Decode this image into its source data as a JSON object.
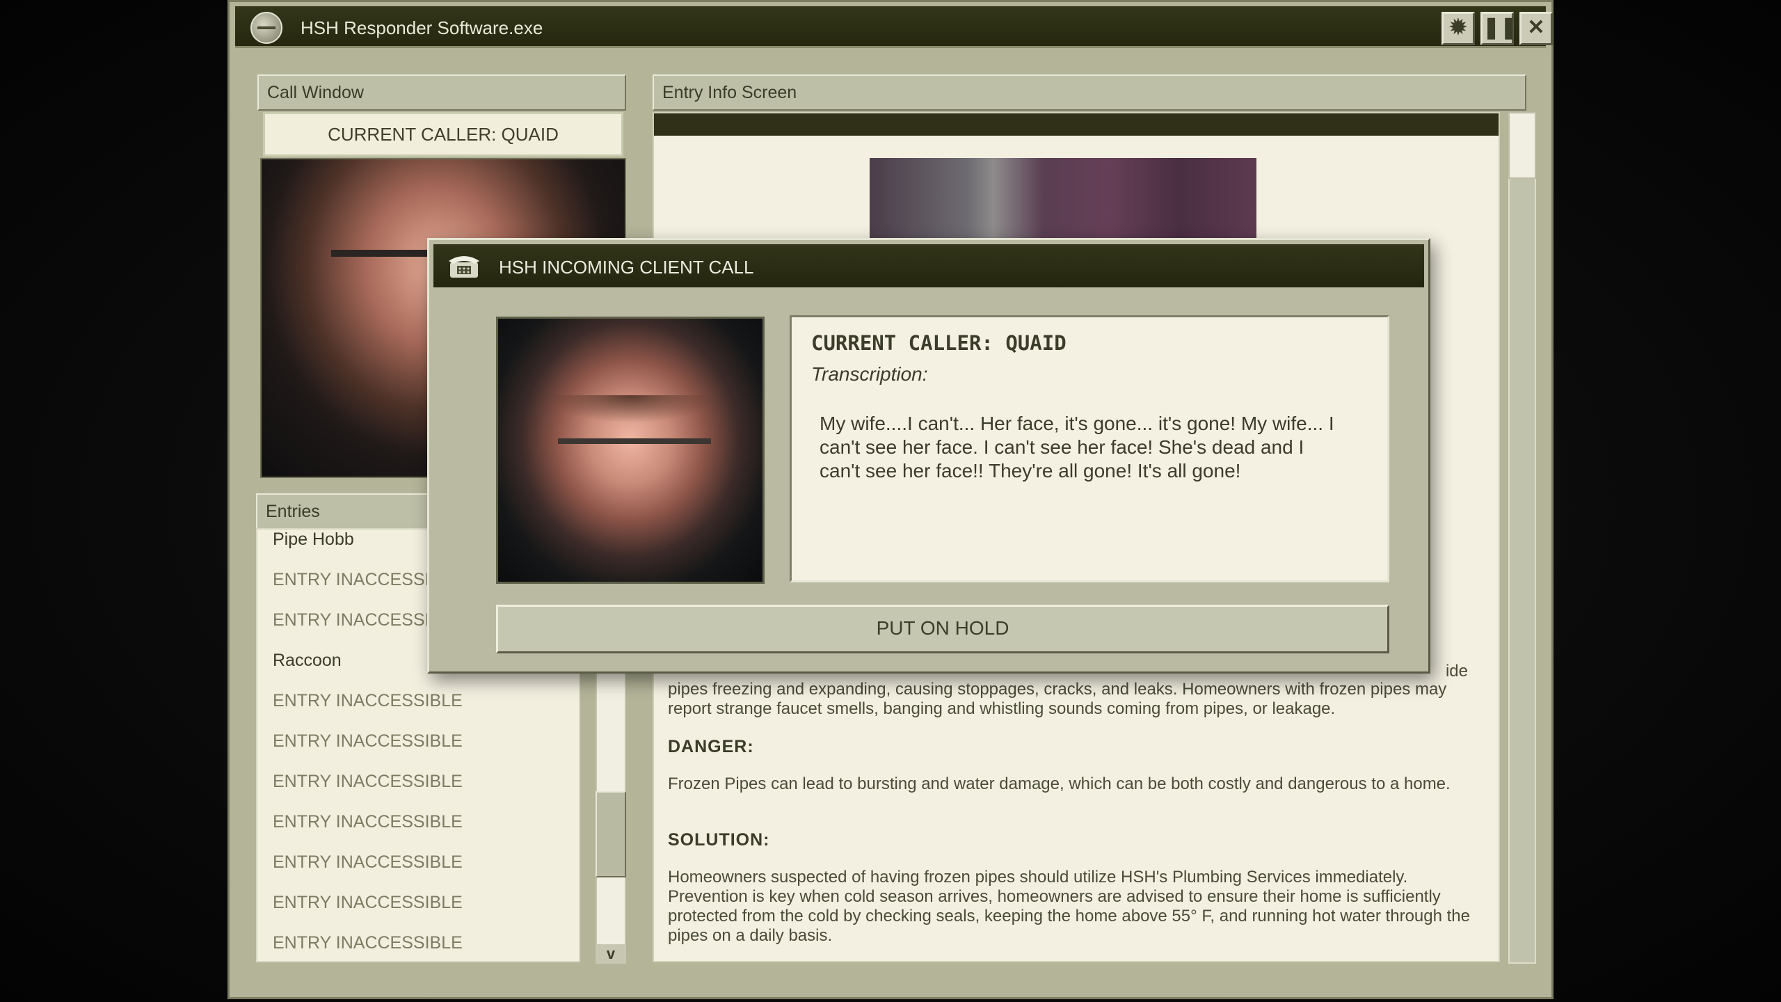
{
  "app": {
    "title": "HSH Responder Software.exe",
    "buttons": [
      "settings",
      "pause",
      "close"
    ]
  },
  "call_window": {
    "header": "Call Window",
    "current_caller": "CURRENT CALLER: QUAID"
  },
  "entries": {
    "header": "Entries",
    "items": [
      "Pipe Hobb",
      "ENTRY INACCESSIBLE",
      "ENTRY INACCESSIBLE",
      "Raccoon",
      "ENTRY INACCESSIBLE",
      "ENTRY INACCESSIBLE",
      "ENTRY INACCESSIBLE",
      "ENTRY INACCESSIBLE",
      "ENTRY INACCESSIBLE",
      "ENTRY INACCESSIBLE",
      "ENTRY INACCESSIBLE"
    ],
    "scroll_arrow": "v"
  },
  "entry_info": {
    "header": "Entry Info Screen",
    "partial_word": "ide",
    "description": "pipes freezing and expanding, causing stoppages, cracks, and leaks. Homeowners with frozen pipes may report strange faucet smells, banging and whistling sounds coming from pipes, or leakage.",
    "danger_heading": "DANGER:",
    "danger_text": "Frozen Pipes can lead to bursting and water damage, which can be both costly and dangerous to a home.",
    "solution_heading": "SOLUTION:",
    "solution_text": "Homeowners suspected of having frozen pipes should utilize HSH's Plumbing Services immediately. Prevention is key when cold season arrives, homeowners are advised to ensure their home is sufficiently protected from the cold by checking seals, keeping the home above 55° F, and running hot water through the pipes on a daily basis."
  },
  "incoming_call": {
    "title": "HSH INCOMING CLIENT CALL",
    "caller": "CURRENT CALLER: QUAID",
    "transcription_label": "Transcription:",
    "transcription": "My wife....I can't... Her face, it's gone... it's gone! My wife... I can't see her face. I can't see her face! She's dead and I can't see her face!! They're all gone! It's all gone!",
    "hold_button": "PUT ON HOLD"
  },
  "icons": {
    "title_logo": "hsh-globe-icon",
    "settings": "gear-icon",
    "pause": "pause-icon",
    "close": "close-icon",
    "modal": "telephone-icon"
  },
  "colors": {
    "titlebar": "#2b2d15",
    "window": "#b3b498",
    "paper": "#f3f0e1",
    "text": "#3c3c2b"
  }
}
